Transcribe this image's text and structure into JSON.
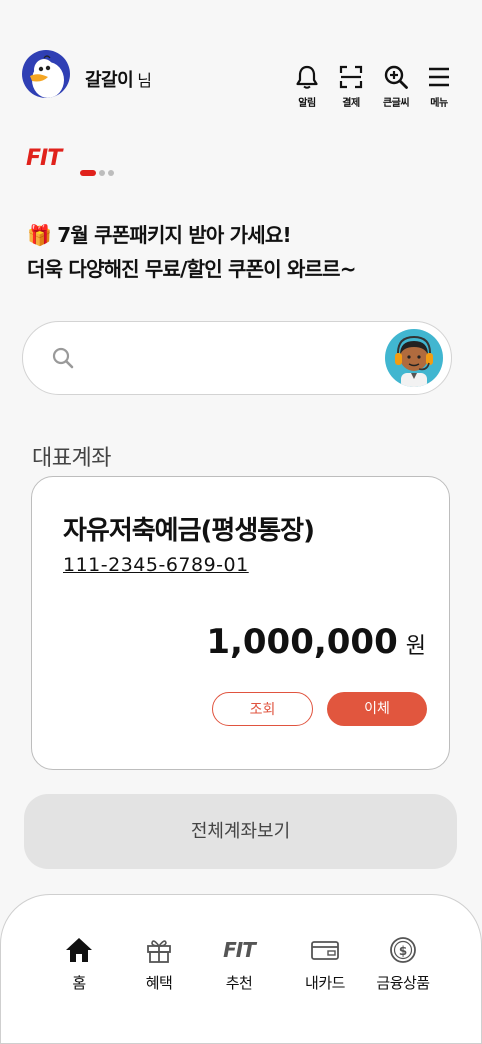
{
  "header": {
    "username": "갈갈이",
    "username_suffix": "님",
    "actions": [
      {
        "label": "알림",
        "icon": "bell-icon"
      },
      {
        "label": "결제",
        "icon": "scan-icon"
      },
      {
        "label": "큰글씨",
        "icon": "zoom-in-icon"
      },
      {
        "label": "메뉴",
        "icon": "menu-icon"
      }
    ]
  },
  "banner": {
    "logo": "FIT",
    "carousel_pages": 3,
    "carousel_active": 1,
    "emoji": "🎁",
    "headline": "7월 쿠폰패키지 받아 가세요!",
    "subline": "더욱 다양해진 무료/할인 쿠폰이 와르르~"
  },
  "search": {
    "placeholder": "",
    "value": ""
  },
  "main_account": {
    "section_title": "대표계좌",
    "name": "자유저축예금(평생통장)",
    "number": "111-2345-6789-01",
    "balance": "1,000,000",
    "currency": "원",
    "inquiry_label": "조회",
    "transfer_label": "이체"
  },
  "all_accounts_label": "전체계좌보기",
  "bottom_nav": [
    {
      "label": "홈",
      "icon": "home-icon"
    },
    {
      "label": "혜택",
      "icon": "gift-icon"
    },
    {
      "label": "추천",
      "icon": "fit-icon",
      "glyph": "FIT"
    },
    {
      "label": "내카드",
      "icon": "card-icon"
    },
    {
      "label": "금융상품",
      "icon": "dollar-coin-icon"
    }
  ],
  "colors": {
    "brand_red": "#e0221c",
    "accent": "#e1563e",
    "avatar_bg": "#2f3fb4",
    "agent_bg": "#41b6d0"
  }
}
